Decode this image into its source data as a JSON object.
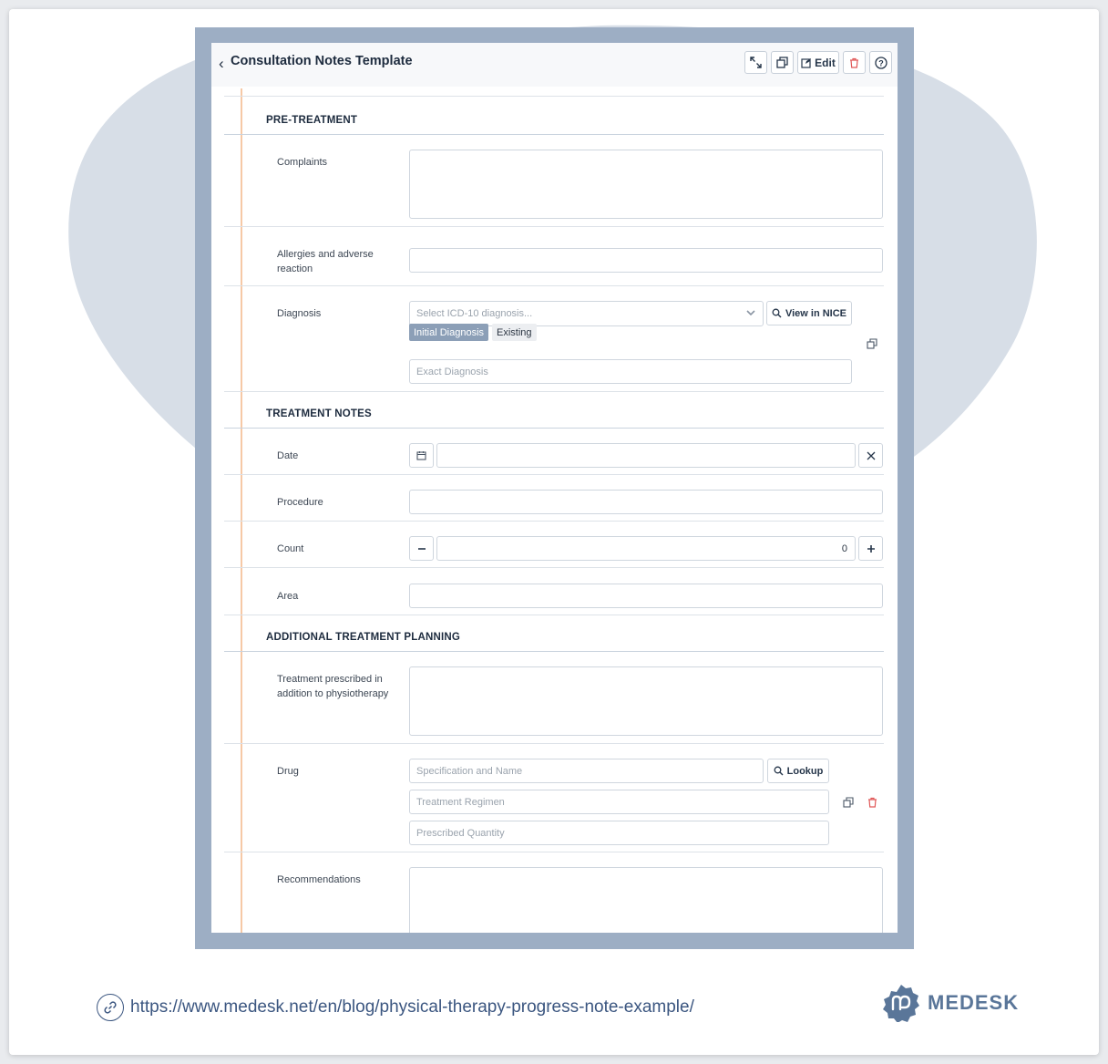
{
  "header": {
    "title": "Consultation Notes Template",
    "edit_label": "Edit"
  },
  "sections": {
    "pre_treatment": "PRE-TREATMENT",
    "treatment_notes": "TREATMENT NOTES",
    "additional_planning": "ADDITIONAL TREATMENT PLANNING"
  },
  "labels": {
    "complaints": "Complaints",
    "allergies": "Allergies and adverse reaction",
    "diagnosis": "Diagnosis",
    "date": "Date",
    "procedure": "Procedure",
    "count": "Count",
    "area": "Area",
    "treatment_prescribed": "Treatment prescribed in addition to physiotherapy",
    "drug": "Drug",
    "recommendations": "Recommendations"
  },
  "diagnosis": {
    "select_placeholder": "Select ICD-10 diagnosis...",
    "view_button": "View in NICE",
    "tag_initial": "Initial Diagnosis",
    "tag_existing": "Existing",
    "exact_placeholder": "Exact Diagnosis"
  },
  "count": {
    "value": "0"
  },
  "drug": {
    "spec_placeholder": "Specification and Name",
    "lookup_button": "Lookup",
    "regimen_placeholder": "Treatment Regimen",
    "quantity_placeholder": "Prescribed Quantity"
  },
  "footer": {
    "url": "https://www.medesk.net/en/blog/physical-therapy-progress-note-example/",
    "brand": "MEDESK"
  },
  "colors": {
    "frame": "#9daec4",
    "blob": "#d7dee7",
    "accent_rail": "#f6c9a6",
    "brand_blue": "#3b5680",
    "delete_red": "#e05757"
  }
}
